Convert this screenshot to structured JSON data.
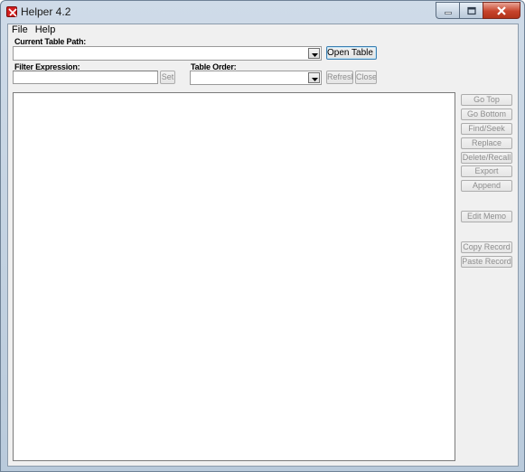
{
  "window": {
    "title": "Helper 4.2",
    "icon": "app-logo-icon",
    "controls": {
      "minimize": "minimize-icon",
      "maximize": "maximize-icon",
      "close": "close-icon"
    }
  },
  "menu": {
    "items": [
      "File",
      "Help"
    ]
  },
  "table_path": {
    "label": "Current Table Path:",
    "value": ""
  },
  "buttons": {
    "open_table": "Open Table ...",
    "set": "Set",
    "refresh": "Refresh",
    "close": "Close"
  },
  "filter": {
    "label": "Filter Expression:",
    "value": ""
  },
  "order": {
    "label": "Table Order:",
    "value": ""
  },
  "side_buttons": [
    "Go Top",
    "Go Bottom",
    "Find/Seek",
    "Replace",
    "Delete/Recall",
    "Export",
    "Append",
    "Edit Memo",
    "Copy Record",
    "Paste Record"
  ],
  "colors": {
    "title_bar": "#cfdbe8",
    "client": "#f0f0f0",
    "close_button": "#c7442c",
    "focus_border": "#3c7fb1"
  }
}
